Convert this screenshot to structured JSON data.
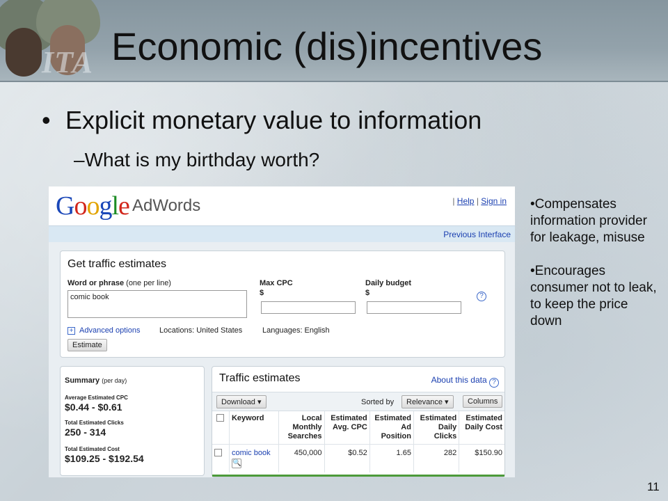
{
  "slide": {
    "title": "Economic (dis)incentives",
    "logo_text": "ITA",
    "bullet": "Explicit monetary value to information",
    "bullet_symbol": "•",
    "sub_bullet": "–What is my birthday worth?",
    "notes": [
      "•Compensates information provider for leakage, misuse",
      "•Encourages consumer not to leak, to keep the price down"
    ],
    "page_number": "11"
  },
  "adwords": {
    "logo": {
      "G": "G",
      "o1": "o",
      "o2": "o",
      "g": "g",
      "l": "l",
      "e": "e"
    },
    "product": "AdWords",
    "links": {
      "sep": "|",
      "help": "Help",
      "sign_in": "Sign in"
    },
    "previous_interface": "Previous Interface",
    "form": {
      "title": "Get traffic estimates",
      "word_label": "Word or phrase",
      "word_hint": "(one per line)",
      "word_value": "comic book",
      "max_cpc_label": "Max CPC",
      "daily_budget_label": "Daily budget",
      "currency": "$",
      "help_icon": "?",
      "advanced_plus": "+",
      "advanced": "Advanced options",
      "locations": "Locations: United States",
      "languages": "Languages: English",
      "estimate_button": "Estimate"
    },
    "summary": {
      "title": "Summary",
      "title_hint": "(per day)",
      "avg_cpc_label": "Average Estimated CPC",
      "avg_cpc_value": "$0.44 - $0.61",
      "clicks_label": "Total Estimated Clicks",
      "clicks_value": "250 - 314",
      "cost_label": "Total Estimated Cost",
      "cost_value": "$109.25 - $192.54"
    },
    "traffic": {
      "title": "Traffic estimates",
      "about": "About this data",
      "about_icon": "?",
      "download_button": "Download ▾",
      "sorted_by": "Sorted by",
      "relevance_button": "Relevance ▾",
      "columns_button": "Columns",
      "headers": [
        "Keyword",
        "Local Monthly Searches",
        "Estimated Avg. CPC",
        "Estimated Ad Position",
        "Estimated Daily Clicks",
        "Estimated Daily Cost"
      ],
      "rows": [
        {
          "keyword": "comic book",
          "searches": "450,000",
          "cpc": "$0.52",
          "position": "1.65",
          "clicks": "282",
          "cost": "$150.90"
        }
      ],
      "magnifier_icon": "🔍"
    }
  }
}
